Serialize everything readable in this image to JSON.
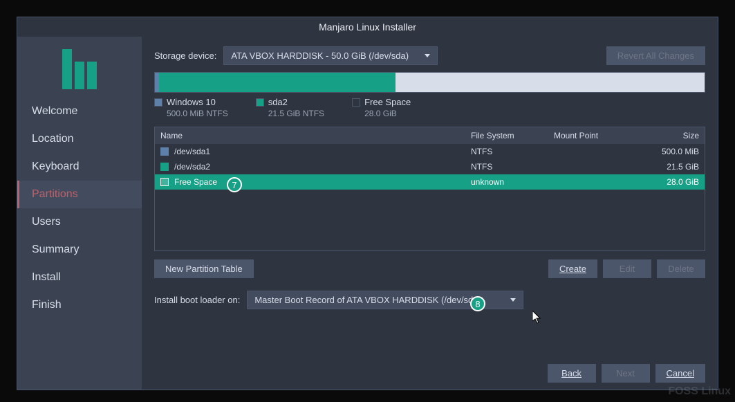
{
  "title": "Manjaro Linux Installer",
  "sidebar": {
    "items": [
      {
        "label": "Welcome"
      },
      {
        "label": "Location"
      },
      {
        "label": "Keyboard"
      },
      {
        "label": "Partitions"
      },
      {
        "label": "Users"
      },
      {
        "label": "Summary"
      },
      {
        "label": "Install"
      },
      {
        "label": "Finish"
      }
    ],
    "active_index": 3
  },
  "storage": {
    "label": "Storage device:",
    "value": "ATA VBOX HARDDISK - 50.0 GiB (/dev/sda)"
  },
  "revert_label": "Revert All Changes",
  "legend": [
    {
      "name": "Windows 10",
      "sub": "500.0 MiB  NTFS",
      "color": "#5e81ac"
    },
    {
      "name": "sda2",
      "sub": "21.5 GiB  NTFS",
      "color": "#16a085"
    },
    {
      "name": "Free Space",
      "sub": "28.0 GiB",
      "color": "transparent"
    }
  ],
  "table": {
    "headers": {
      "name": "Name",
      "fs": "File System",
      "mount": "Mount Point",
      "size": "Size"
    },
    "rows": [
      {
        "name": "/dev/sda1",
        "fs": "NTFS",
        "mount": "",
        "size": "500.0 MiB",
        "color": "#5e81ac"
      },
      {
        "name": "/dev/sda2",
        "fs": "NTFS",
        "mount": "",
        "size": "21.5 GiB",
        "color": "#16a085"
      },
      {
        "name": "Free Space",
        "fs": "unknown",
        "mount": "",
        "size": "28.0 GiB",
        "color": "transparent"
      }
    ],
    "selected_index": 2
  },
  "actions": {
    "new_partition_table": "New Partition Table",
    "create": "Create",
    "edit": "Edit",
    "delete": "Delete"
  },
  "bootloader": {
    "label": "Install boot loader on:",
    "value": "Master Boot Record of ATA VBOX HARDDISK (/dev/sda)"
  },
  "footer": {
    "back": "Back",
    "next": "Next",
    "cancel": "Cancel"
  },
  "callouts": {
    "seven": "7",
    "eight": "8"
  },
  "watermark": "FOSS Linux"
}
